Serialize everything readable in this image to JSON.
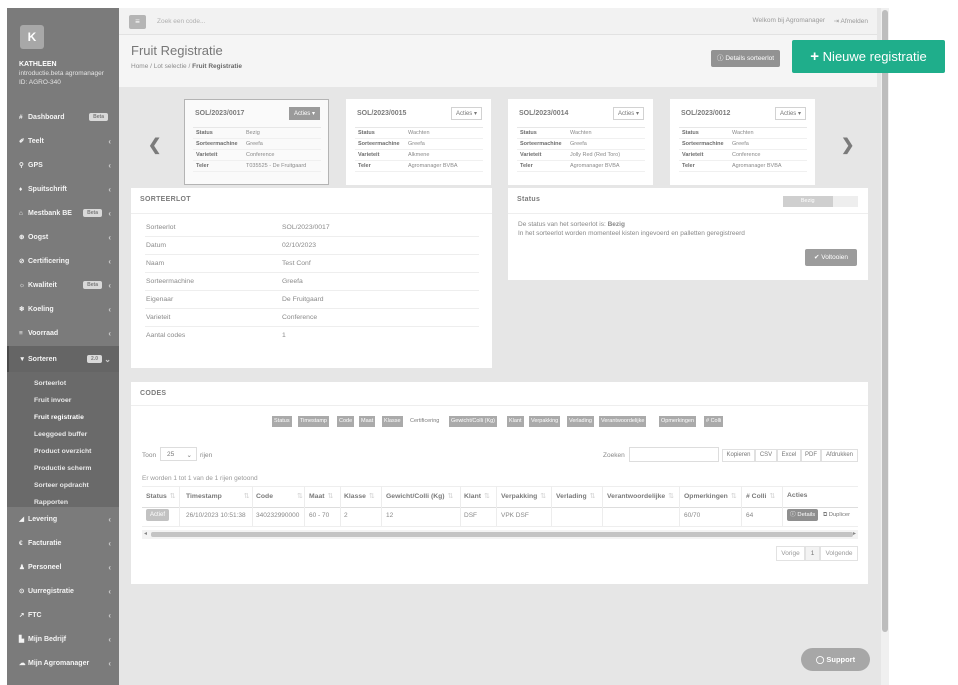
{
  "sidebar": {
    "logo": "K",
    "user_name": "KATHLEEN",
    "user_company": "introductie.beta agromanager",
    "user_id": "ID: AGRO-340",
    "items": [
      {
        "icon": "#",
        "label": "Dashboard",
        "badge": "Beta",
        "top": 0
      },
      {
        "icon": "✐",
        "label": "Teelt"
      },
      {
        "icon": "⚲",
        "label": "GPS"
      },
      {
        "icon": "♦",
        "label": "Spuitschrift"
      },
      {
        "icon": "⌂",
        "label": "Mestbank BE",
        "badge": "Beta"
      },
      {
        "icon": "⊕",
        "label": "Oogst"
      },
      {
        "icon": "⊘",
        "label": "Certificering"
      },
      {
        "icon": "☼",
        "label": "Kwaliteit",
        "badge": "Beta"
      },
      {
        "icon": "❄",
        "label": "Koeling"
      },
      {
        "icon": "≡",
        "label": "Voorraad"
      },
      {
        "icon": "▼",
        "label": "Sorteren",
        "badge": "2.0"
      }
    ],
    "sub_items": [
      "Sorteerlot",
      "Fruit invoer",
      "Fruit registratie",
      "Leeggoed buffer",
      "Product overzicht",
      "Productie scherm",
      "Sorteer opdracht",
      "Rapporten"
    ],
    "items_bottom": [
      {
        "icon": "◢",
        "label": "Levering"
      },
      {
        "icon": "€",
        "label": "Facturatie"
      },
      {
        "icon": "♟",
        "label": "Personeel"
      },
      {
        "icon": "⊙",
        "label": "Uurregistratie"
      },
      {
        "icon": "↗",
        "label": "FTC"
      },
      {
        "icon": "▙",
        "label": "Mijn Bedrijf"
      },
      {
        "icon": "☁",
        "label": "Mijn Agromanager"
      }
    ]
  },
  "topbar": {
    "search_placeholder": "Zoek een code...",
    "welcome": "Welkom bij Agromanager",
    "logout": "Afmelden"
  },
  "header": {
    "title": "Fruit Registratie",
    "crumb_home": "Home",
    "crumb_lot": "Lot selectie",
    "crumb_current": "Fruit Registratie",
    "details_btn": "Details sorteerlot",
    "new_btn": "Nieuwe registratie"
  },
  "carousel": {
    "actions_label": "Acties",
    "field_labels": [
      "Status",
      "Sorteermachine",
      "Varieteit",
      "Teler"
    ],
    "cards": [
      {
        "code": "SOL/2023/0017",
        "values": [
          "Bezig",
          "Greefa",
          "Conference",
          "T035525 - De Fruitgaard"
        ]
      },
      {
        "code": "SOL/2023/0015",
        "values": [
          "Wachten",
          "Greefa",
          "Alkmene",
          "Agromanager BVBA"
        ]
      },
      {
        "code": "SOL/2023/0014",
        "values": [
          "Wachten",
          "Greefa",
          "Jolly Red (Red Toro)",
          "Agromanager BVBA"
        ]
      },
      {
        "code": "SOL/2023/0012",
        "values": [
          "Wachten",
          "Greefa",
          "Conference",
          "Agromanager BVBA"
        ]
      }
    ]
  },
  "sorteerlot": {
    "title": "SORTEERLOT",
    "rows": [
      {
        "k": "Sorteerlot",
        "v": "SOL/2023/0017"
      },
      {
        "k": "Datum",
        "v": "02/10/2023"
      },
      {
        "k": "Naam",
        "v": "Test Conf"
      },
      {
        "k": "Sorteermachine",
        "v": "Greefa"
      },
      {
        "k": "Eigenaar",
        "v": "De Fruitgaard"
      },
      {
        "k": "Varieteit",
        "v": "Conference"
      },
      {
        "k": "Aantal codes",
        "v": "1"
      }
    ]
  },
  "status_panel": {
    "title": "Status",
    "bar_label": "Bezig",
    "progress_fraction": 0.66,
    "line1_prefix": "De status van het sorteerlot is:",
    "line1_value": "Bezig",
    "line2": "In het sorteerlot worden momenteel kisten ingevoerd en palletten geregistreerd",
    "complete_btn": "Voltooien"
  },
  "codes": {
    "title": "CODES",
    "column_toggles": [
      {
        "label": "Status",
        "on": true
      },
      {
        "label": "Timestamp",
        "on": true
      },
      {
        "label": "Code",
        "on": true
      },
      {
        "label": "Maat",
        "on": true
      },
      {
        "label": "Klasse",
        "on": true
      },
      {
        "label": "Certificering",
        "on": false
      },
      {
        "label": "Gewicht/Colli (Kg)",
        "on": true
      },
      {
        "label": "Klant",
        "on": true
      },
      {
        "label": "Verpakking",
        "on": true
      },
      {
        "label": "Verlading",
        "on": true
      },
      {
        "label": "Verantwoordelijke",
        "on": true
      },
      {
        "label": "Opmerkingen",
        "on": true
      },
      {
        "label": "# Colli",
        "on": true
      }
    ],
    "show_label": "Toon",
    "show_value": "25",
    "rows_label": "rijen",
    "search_label": "Zoeken",
    "export_buttons": [
      "Kopieren",
      "CSV",
      "Excel",
      "PDF",
      "Afdrukken"
    ],
    "info": "Er worden 1 tot 1 van de 1 rijen getoond",
    "headers": [
      "Status",
      "Timestamp",
      "Code",
      "Maat",
      "Klasse",
      "Gewicht/Colli (Kg)",
      "Klant",
      "Verpakking",
      "Verlading",
      "Verantwoordelijke",
      "Opmerkingen",
      "# Colli",
      "Acties"
    ],
    "row": {
      "status": "Actief",
      "timestamp": "26/10/2023 10:51:38",
      "code": "340232990000",
      "maat": "60 - 70",
      "klasse": "2",
      "gewicht": "12",
      "klant": "DSF",
      "verpakking": "VPK DSF",
      "verlading": "",
      "verantwoordelijke": "",
      "opmerkingen": "60/70",
      "colli": "64",
      "details_btn": "Details",
      "duplicate_btn": "Duplicer"
    },
    "pager_prev": "Vorige",
    "pager_page": "1",
    "pager_next": "Volgende"
  },
  "support": "Support"
}
